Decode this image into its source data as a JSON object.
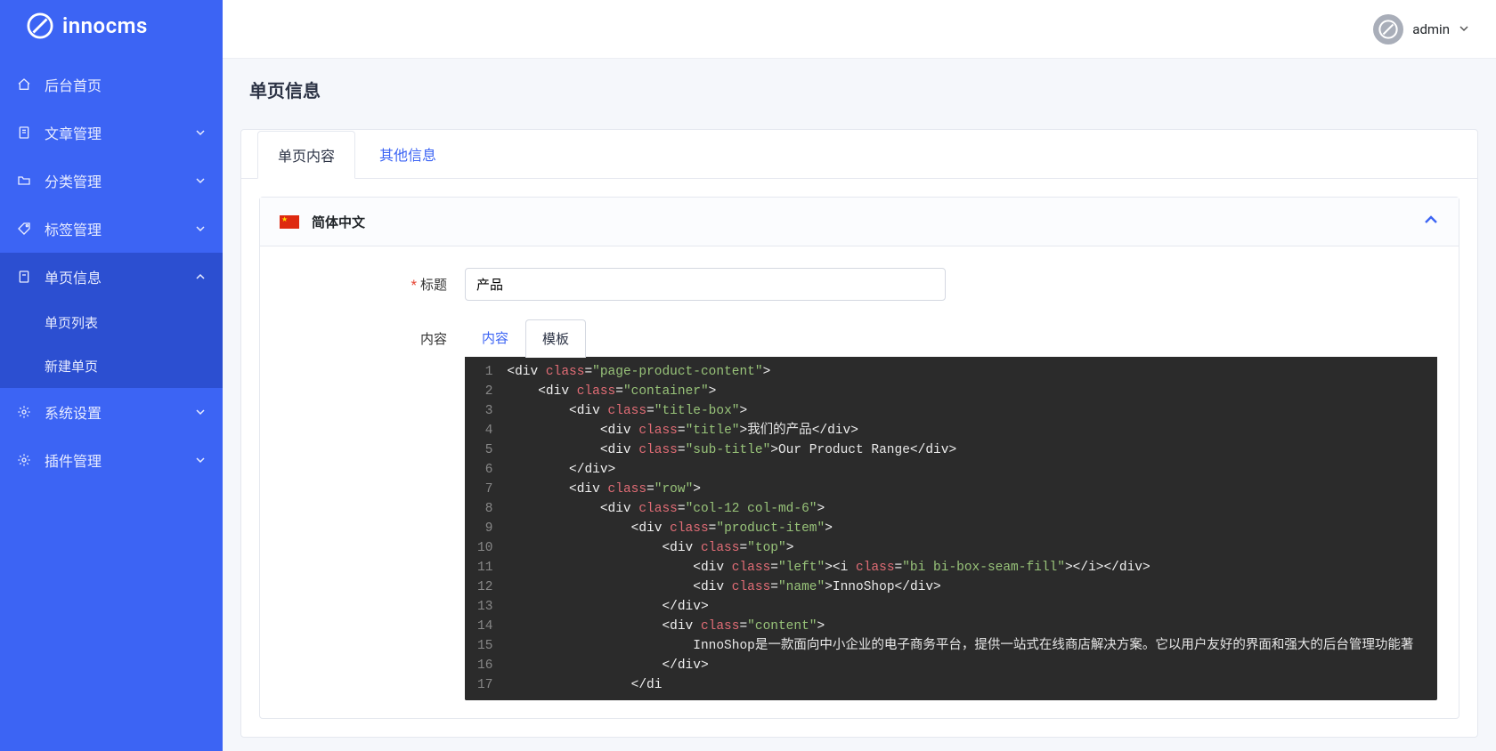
{
  "brand": {
    "name": "innocms"
  },
  "user": {
    "name": "admin"
  },
  "sidebar": {
    "items": [
      {
        "label": "后台首页",
        "icon": "home-icon",
        "expandable": false
      },
      {
        "label": "文章管理",
        "icon": "document-icon",
        "expandable": true
      },
      {
        "label": "分类管理",
        "icon": "folder-icon",
        "expandable": true
      },
      {
        "label": "标签管理",
        "icon": "tag-icon",
        "expandable": true
      },
      {
        "label": "单页信息",
        "icon": "page-icon",
        "expandable": true,
        "active": true,
        "children": [
          {
            "label": "单页列表"
          },
          {
            "label": "新建单页"
          }
        ]
      },
      {
        "label": "系统设置",
        "icon": "gear-icon",
        "expandable": true
      },
      {
        "label": "插件管理",
        "icon": "gear-icon",
        "expandable": true
      }
    ]
  },
  "page": {
    "title": "单页信息",
    "tabs": [
      {
        "label": "单页内容",
        "active": true
      },
      {
        "label": "其他信息",
        "active": false
      }
    ],
    "language_panel": {
      "label": "简体中文",
      "expanded": true
    },
    "form": {
      "title_label": "标题",
      "title_value": "产品",
      "content_label": "内容",
      "content_tabs": [
        {
          "label": "内容",
          "active": false
        },
        {
          "label": "模板",
          "active": true
        }
      ]
    },
    "code": {
      "lines": [
        {
          "n": 1,
          "ind": 0,
          "type": "open",
          "tag": "div",
          "attr": "class",
          "val": "page-product-content"
        },
        {
          "n": 2,
          "ind": 4,
          "type": "open",
          "tag": "div",
          "attr": "class",
          "val": "container"
        },
        {
          "n": 3,
          "ind": 8,
          "type": "open",
          "tag": "div",
          "attr": "class",
          "val": "title-box"
        },
        {
          "n": 4,
          "ind": 12,
          "type": "full",
          "tag": "div",
          "attr": "class",
          "val": "title",
          "text": "我们的产品"
        },
        {
          "n": 5,
          "ind": 12,
          "type": "full",
          "tag": "div",
          "attr": "class",
          "val": "sub-title",
          "text": "Our Product Range"
        },
        {
          "n": 6,
          "ind": 8,
          "type": "close",
          "tag": "div"
        },
        {
          "n": 7,
          "ind": 8,
          "type": "open",
          "tag": "div",
          "attr": "class",
          "val": "row"
        },
        {
          "n": 8,
          "ind": 12,
          "type": "open",
          "tag": "div",
          "attr": "class",
          "val": "col-12 col-md-6"
        },
        {
          "n": 9,
          "ind": 16,
          "type": "open",
          "tag": "div",
          "attr": "class",
          "val": "product-item"
        },
        {
          "n": 10,
          "ind": 20,
          "type": "open",
          "tag": "div",
          "attr": "class",
          "val": "top"
        },
        {
          "n": 11,
          "ind": 24,
          "type": "left_i",
          "tag": "div",
          "attr": "class",
          "val": "left",
          "iattr": "class",
          "ival": "bi bi-box-seam-fill"
        },
        {
          "n": 12,
          "ind": 24,
          "type": "full",
          "tag": "div",
          "attr": "class",
          "val": "name",
          "text": "InnoShop"
        },
        {
          "n": 13,
          "ind": 20,
          "type": "close",
          "tag": "div"
        },
        {
          "n": 14,
          "ind": 20,
          "type": "open",
          "tag": "div",
          "attr": "class",
          "val": "content"
        },
        {
          "n": 15,
          "ind": 24,
          "type": "text",
          "text": "InnoShop是一款面向中小企业的电子商务平台，提供一站式在线商店解决方案。它以用户友好的界面和强大的后台管理功能著"
        },
        {
          "n": 16,
          "ind": 20,
          "type": "close",
          "tag": "div"
        },
        {
          "n": 17,
          "ind": 16,
          "type": "partial_close",
          "tag": "div"
        }
      ]
    }
  }
}
